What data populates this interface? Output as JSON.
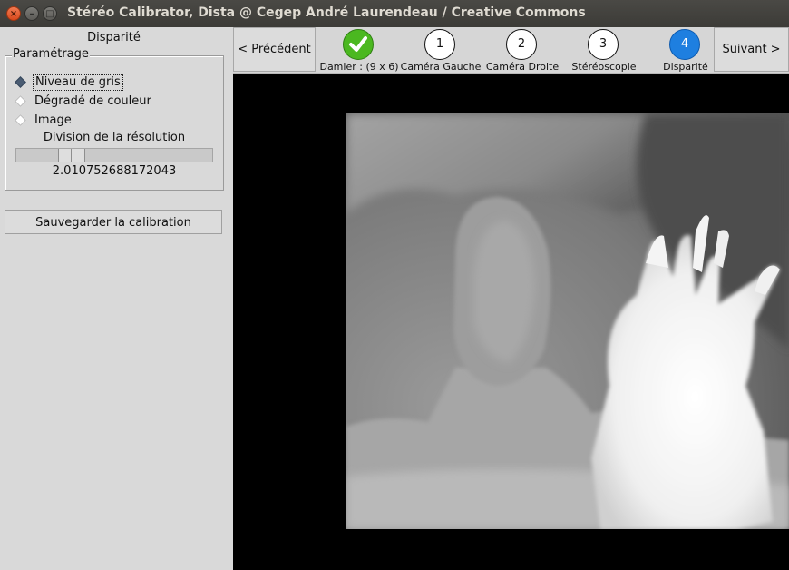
{
  "window": {
    "title": "Stéréo Calibrator, Dista @ Cegep André Laurendeau / Creative Commons",
    "close_glyph": "×",
    "minimize_glyph": "–",
    "maximize_glyph": "□"
  },
  "sidebar": {
    "heading": "Disparité",
    "settings_group": {
      "legend": "Paramétrage",
      "options": [
        {
          "label": "Niveau de gris",
          "selected": true
        },
        {
          "label": "Dégradé de couleur",
          "selected": false
        },
        {
          "label": "Image",
          "selected": false
        }
      ],
      "resolution_label": "Division de la résolution",
      "resolution_value": "2.010752688172043"
    },
    "save_button": "Sauvegarder la calibration"
  },
  "nav": {
    "prev_label": "< Précédent",
    "next_label": "Suivant >",
    "steps": [
      {
        "number": "",
        "caption": "Damier : (9 x 6)",
        "state": "done",
        "icon": "check-icon"
      },
      {
        "number": "1",
        "caption": "Caméra Gauche",
        "state": "pending"
      },
      {
        "number": "2",
        "caption": "Caméra Droite",
        "state": "pending"
      },
      {
        "number": "3",
        "caption": "Stéréoscopie",
        "state": "pending"
      },
      {
        "number": "4",
        "caption": "Disparité",
        "state": "active"
      }
    ]
  },
  "colors": {
    "done": "#4bb820",
    "active": "#1e7fe0",
    "titlebar": "#3c3b37"
  }
}
